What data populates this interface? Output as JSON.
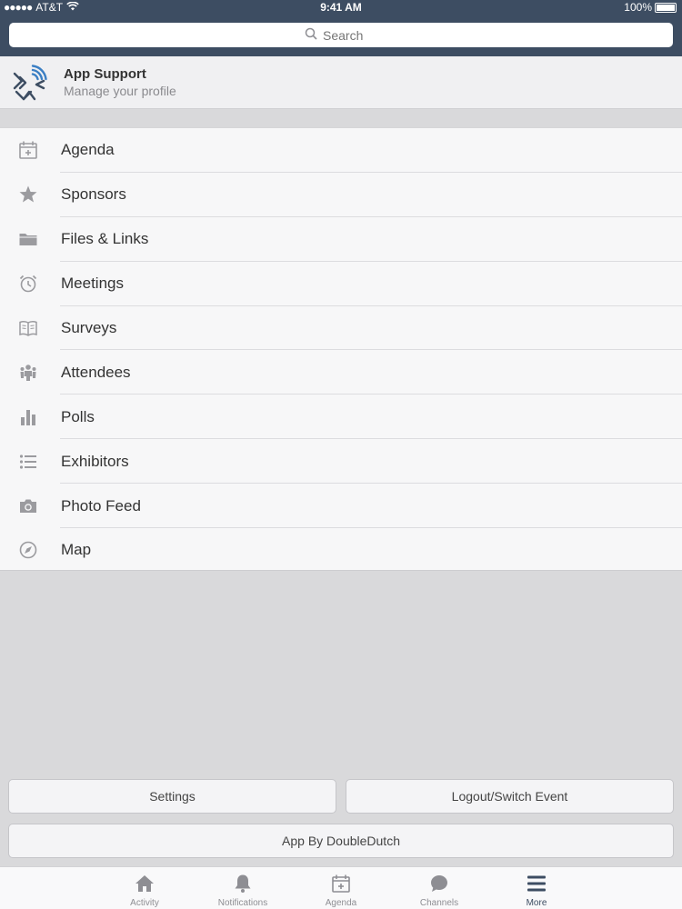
{
  "status_bar": {
    "carrier": "AT&T",
    "time": "9:41 AM",
    "battery": "100%"
  },
  "search": {
    "placeholder": "Search"
  },
  "profile": {
    "name": "App Support",
    "subtitle": "Manage your profile"
  },
  "menu": {
    "items": [
      {
        "label": "Agenda",
        "icon": "calendar-icon"
      },
      {
        "label": "Sponsors",
        "icon": "star-icon"
      },
      {
        "label": "Files & Links",
        "icon": "folder-icon"
      },
      {
        "label": "Meetings",
        "icon": "alarm-clock-icon"
      },
      {
        "label": "Surveys",
        "icon": "open-book-icon"
      },
      {
        "label": "Attendees",
        "icon": "people-icon"
      },
      {
        "label": "Polls",
        "icon": "bar-chart-icon"
      },
      {
        "label": "Exhibitors",
        "icon": "list-icon"
      },
      {
        "label": "Photo Feed",
        "icon": "camera-icon"
      },
      {
        "label": "Map",
        "icon": "compass-icon"
      }
    ]
  },
  "buttons": {
    "settings": "Settings",
    "logout": "Logout/Switch Event",
    "doubledutch": "App By DoubleDutch"
  },
  "tabbar": {
    "tabs": [
      {
        "label": "Activity",
        "icon": "home-icon"
      },
      {
        "label": "Notifications",
        "icon": "bell-icon"
      },
      {
        "label": "Agenda",
        "icon": "calendar-icon"
      },
      {
        "label": "Channels",
        "icon": "chat-bubble-icon"
      },
      {
        "label": "More",
        "icon": "menu-icon",
        "active": true
      }
    ]
  },
  "colors": {
    "header": "#3d4d62",
    "icon_gray": "#9b9b9f",
    "logo_blue": "#3b7fc4"
  }
}
